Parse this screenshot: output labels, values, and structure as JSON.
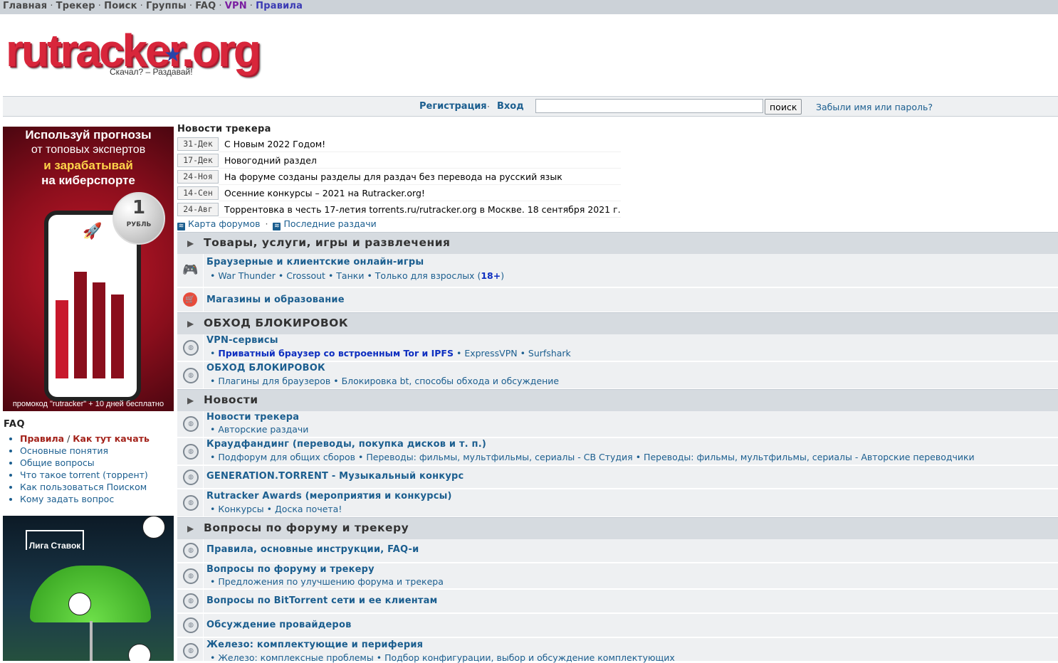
{
  "topnav": {
    "home": "Главная",
    "tracker": "Трекер",
    "search": "Поиск",
    "groups": "Группы",
    "faq": "FAQ",
    "vpn": "VPN",
    "rules": "Правила",
    "sep": "·"
  },
  "logo": {
    "text_main": "rutracker",
    "text_tld": "org",
    "slogan": "Скачал? – Раздавай!"
  },
  "login": {
    "register": "Регистрация",
    "sep": "·",
    "login": "Вход",
    "search_value": "",
    "search_button": "поиск",
    "forgot": "Забыли имя или пароль?"
  },
  "ad1": {
    "line1": "Используй прогнозы",
    "line2": "от топовых экспертов",
    "line3": "и зарабатывай",
    "line4": "на киберспорте",
    "coin_value": "1",
    "coin_caption": "РУБЛЬ",
    "promo": "промокод \"rutracker\" + 10 дней бесплатно"
  },
  "faq": {
    "title": "FAQ",
    "rules": "Правила",
    "slash": "/",
    "how_to_download": "Как тут качать",
    "items": [
      "Основные понятия",
      "Общие вопросы",
      "Что такое torrent (торрент)",
      "Как пользоваться Поиском",
      "Кому задать вопрос"
    ]
  },
  "ad2": {
    "brand": "Лига Ставок"
  },
  "news": {
    "title": "Новости трекера",
    "items": [
      {
        "date": "31-Дек",
        "text": "С Новым 2022 Годом!"
      },
      {
        "date": "17-Дек",
        "text": "Новогодний раздел"
      },
      {
        "date": "24-Ноя",
        "text": "На форуме созданы разделы для раздач без перевода на русский язык"
      },
      {
        "date": "14-Сен",
        "text": "Осенние конкурсы – 2021 на Rutracker.org!"
      },
      {
        "date": "24-Авг",
        "text": "Торрентовка в честь 17-летия torrents.ru/rutracker.org в Москве. 18 сентября 2021 г."
      }
    ],
    "map_link": "Карта форумов",
    "latest_link": "Последние раздачи",
    "sep": "·"
  },
  "categories": [
    {
      "name": "Товары, услуги, игры и развлечения"
    },
    {
      "name": "ОБХОД БЛОКИРОВОК"
    },
    {
      "name": "Новости"
    },
    {
      "name": "Вопросы по форуму и трекеру"
    }
  ],
  "forums": {
    "games": {
      "name": "Браузерные и клиентские онлайн-игры",
      "subs": [
        "War Thunder",
        "Crossout",
        "Танки",
        "Только для взрослых"
      ],
      "adult_mark": "18+"
    },
    "shops": {
      "name": "Магазины и образование"
    },
    "vpn": {
      "name": "VPN-сервисы",
      "subs": [
        "Приватный браузер со встроенным Tor и IPFS",
        "ExpressVPN",
        "Surfshark"
      ]
    },
    "bypass": {
      "name": "ОБХОД БЛОКИРОВОК",
      "subs": [
        "Плагины для браузеров",
        "Блокировка bt, способы обхода и обсуждение"
      ]
    },
    "tracker_news": {
      "name": "Новости трекера",
      "subs": [
        "Авторские раздачи"
      ]
    },
    "crowdfunding": {
      "name": "Краудфандинг (переводы, покупка дисков и т. п.)",
      "subs": [
        "Подфорум для общих сборов",
        "Переводы: фильмы, мультфильмы, сериалы - СВ Студия",
        "Переводы: фильмы, мультфильмы, сериалы - Авторские переводчики"
      ]
    },
    "generation": {
      "name": "GENERATION.TORRENT - Музыкальный конкурс"
    },
    "awards": {
      "name": "Rutracker Awards (мероприятия и конкурсы)",
      "subs": [
        "Конкурсы",
        "Доска почета!"
      ]
    },
    "rules_faq": {
      "name": "Правила, основные инструкции, FAQ-и"
    },
    "forum_questions": {
      "name": "Вопросы по форуму и трекеру",
      "subs": [
        "Предложения по улучшению форума и трекера"
      ]
    },
    "bittorrent": {
      "name": "Вопросы по BitTorrent сети и ее клиентам"
    },
    "providers": {
      "name": "Обсуждение провайдеров"
    },
    "hardware": {
      "name": "Железо: комплектующие и периферия",
      "subs": [
        "Железо: комплексные проблемы",
        "Подбор конфигурации, выбор и обсуждение комплектующих"
      ]
    }
  },
  "bullet": "•"
}
